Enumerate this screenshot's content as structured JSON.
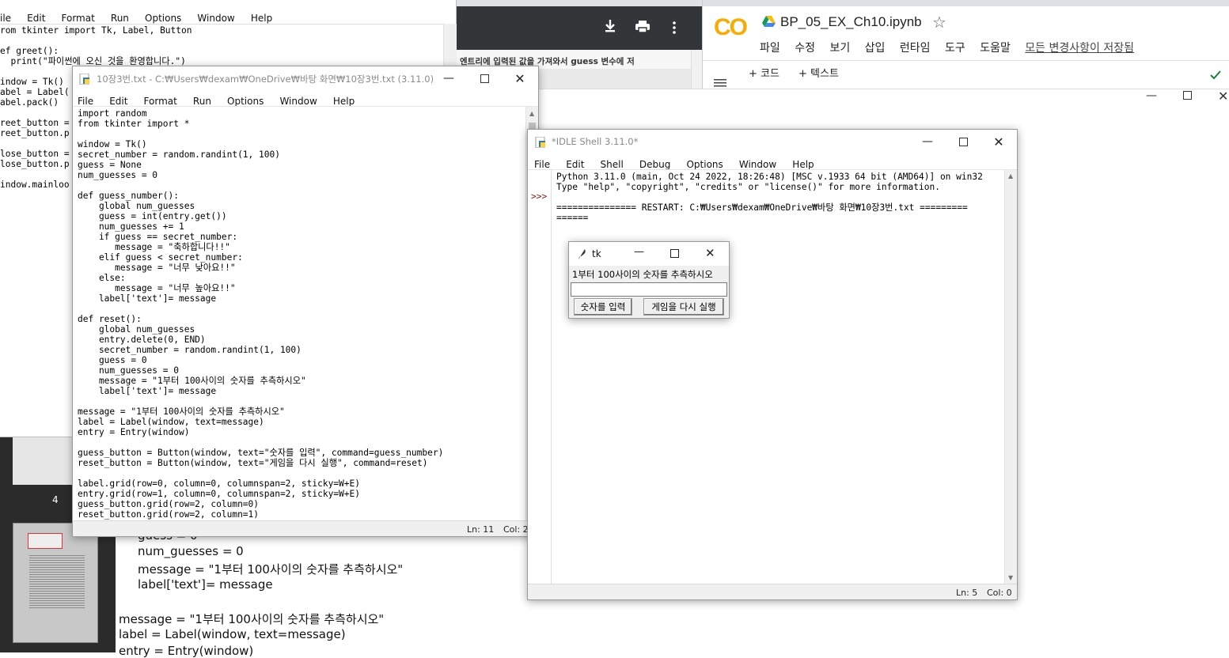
{
  "editor_bg": {
    "menu": [
      "ile",
      "Edit",
      "Format",
      "Run",
      "Options",
      "Window",
      "Help"
    ],
    "code": "rom tkinter import Tk, Label, Button\n\nef greet():\n  print(\"파이썬에 오신 것을 환영합니다.\")\n\nindow = Tk()\nabel = Label(\nabel.pack()\n\nreet_button =\nreet_button.p\n\nlose_button =\nlose_button.p\n\nindow.mainloo"
  },
  "chrome_dark": {
    "download_icon": "download-icon",
    "print_icon": "print-icon",
    "more_icon": "more-icon",
    "text": "엔트리에 입력된 값을 가져와서 guess 변수에 저"
  },
  "colab": {
    "logo": "CO",
    "title": "BP_05_EX_Ch10.ipynb",
    "star": "☆",
    "menu": [
      "파일",
      "수정",
      "보기",
      "삽입",
      "런타임",
      "도구",
      "도움말"
    ],
    "saved_status": "모든 변경사항이 저장됨",
    "add_code": "+ 코드",
    "add_text": "+ 텍스트"
  },
  "slide_panel": {
    "slide_number": "4"
  },
  "doc_bg": {
    "lines": [
      "guess = 0",
      "num_guesses = 0",
      "message = \"1부터 100사이의 숫자를 추측하시오\"",
      "label['text']= message",
      "message = \"1부터 100사이의 숫자를 추측하시오\"",
      "label = Label(window, text=message)",
      "entry = Entry(window)"
    ]
  },
  "editor_main": {
    "title": "10장3번.txt - C:₩Users₩dexam₩OneDrive₩바탕 화면₩10장3번.txt (3.11.0)",
    "menu": [
      "File",
      "Edit",
      "Format",
      "Run",
      "Options",
      "Window",
      "Help"
    ],
    "code": "import random\nfrom tkinter import *\n\nwindow = Tk()\nsecret_number = random.randint(1, 100)\nguess = None\nnum_guesses = 0\n\ndef guess_number():\n    global num_guesses\n    guess = int(entry.get())\n    num_guesses += 1\n    if guess == secret_number:\n       message = \"축하합니다!!\"\n    elif guess < secret_number:\n       message = \"너무 낮아요!!\"\n    else:\n       message = \"너무 높아요!!\"\n    label['text']= message\n\ndef reset():\n    global num_guesses\n    entry.delete(0, END)\n    secret_number = random.randint(1, 100)\n    guess = 0\n    num_guesses = 0\n    message = \"1부터 100사이의 숫자를 추측하시오\"\n    label['text']= message\n\nmessage = \"1부터 100사이의 숫자를 추측하시오\"\nlabel = Label(window, text=message)\nentry = Entry(window)\n\nguess_button = Button(window, text=\"숫자를 입력\", command=guess_number)\nreset_button = Button(window, text=\"게임을 다시 실행\", command=reset)\n\nlabel.grid(row=0, column=0, columnspan=2, sticky=W+E)\nentry.grid(row=1, column=0, columnspan=2, sticky=W+E)\nguess_button.grid(row=2, column=0)\nreset_button.grid(row=2, column=1)",
    "status_ln": "Ln: 11",
    "status_col": "Col: 2"
  },
  "shell": {
    "title": "*IDLE Shell 3.11.0*",
    "menu": [
      "File",
      "Edit",
      "Shell",
      "Debug",
      "Options",
      "Window",
      "Help"
    ],
    "prompt": ">>>",
    "output": "Python 3.11.0 (main, Oct 24 2022, 18:26:48) [MSC v.1933 64 bit (AMD64)] on win32\nType \"help\", \"copyright\", \"credits\" or \"license()\" for more information.\n\n=============== RESTART: C:₩Users₩dexam₩OneDrive₩바탕 화면₩10장3번.txt =========\n======",
    "status_ln": "Ln: 5",
    "status_col": "Col: 0"
  },
  "tk_app": {
    "title": "tk",
    "label": "1부터 100사이의 숫자를 추측하시오",
    "entry_value": "",
    "guess_button": "숫자를 입력",
    "reset_button": "게임을 다시 실행"
  }
}
